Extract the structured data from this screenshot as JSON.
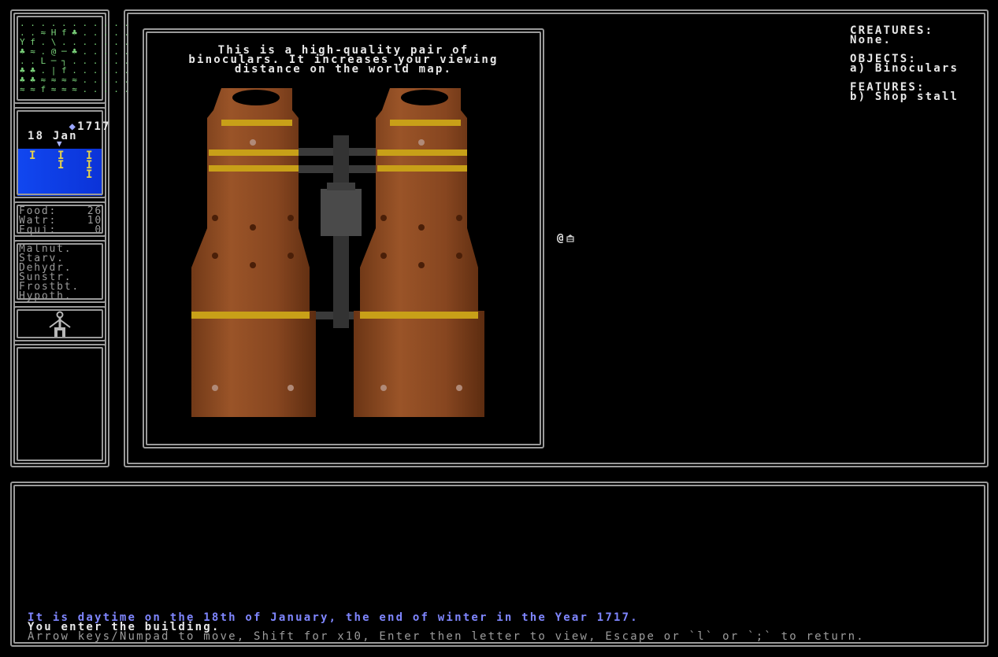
{
  "minimap": {
    "rows": [
      ". . . . . . . . . . .",
      ". . ≈ H f ♣ . . . . .",
      "Y f . \\ . . . . . . .",
      "♣ ≈ . @ ─ ♣ . . . . .",
      ". . L ─ ┐ . . . . . .",
      "♣ ♣ . | f . . . . . .",
      "♣ ♣ ≈ ≈ ≈ ≈ . . . . .",
      "≈ ≈ f ≈ ≈ ≈ . . . . ."
    ]
  },
  "calendar": {
    "money_icon": "◆",
    "money": "1717",
    "date": "18 Jan",
    "marker": "▼",
    "weather_cols": [
      "I",
      "I\nI",
      "I\nI\nI"
    ],
    "sky_color": "#0d3be8"
  },
  "stats": [
    {
      "label": "Food:",
      "value": "26"
    },
    {
      "label": "Watr:",
      "value": "10"
    },
    {
      "label": "Equi:",
      "value": "0"
    }
  ],
  "conditions": [
    "Malnut.",
    "Starv.",
    "Dehydr.",
    "Sunstr.",
    "Frostbt.",
    "Hypoth."
  ],
  "body_icon": "person-figure-icon",
  "viewer": {
    "description": "This is a high-quality pair of\nbinoculars. It increases your viewing\ndistance on the world map.",
    "image_icon": "binoculars-icon"
  },
  "map": {
    "player_glyph": "@",
    "stall_icon": "shop-stall-icon"
  },
  "sidepanel": {
    "creatures_title": "CREATURES:",
    "creatures_value": "None.",
    "objects_title": "OBJECTS:",
    "objects_value": "a) Binoculars",
    "features_title": "FEATURES:",
    "features_value": "b) Shop stall"
  },
  "log": {
    "line1": "It is daytime on the 18th of January, the end of winter in the Year 1717.",
    "line2": "You enter the building.",
    "line3": "Arrow keys/Numpad to move, Shift for x10, Enter then letter to view, Escape or `l` or `;` to return."
  },
  "colors": {
    "frame": "#9a9a9a",
    "log_highlight": "#7f86ff",
    "help_text": "#9c9c9c",
    "binocular_body": "#8a4a22",
    "binocular_band": "#c8a018"
  }
}
